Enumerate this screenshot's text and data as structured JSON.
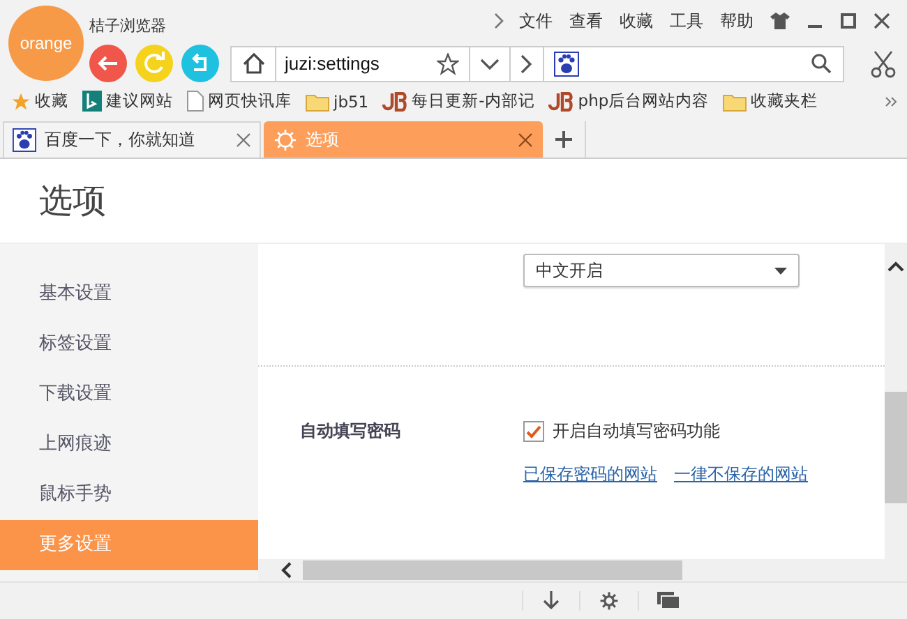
{
  "app": {
    "logo": "orange",
    "title": "桔子浏览器"
  },
  "menu": [
    "文件",
    "查看",
    "收藏",
    "工具",
    "帮助"
  ],
  "address": {
    "value": "juzi:settings"
  },
  "bookmarks": [
    {
      "kind": "star",
      "label": "收藏"
    },
    {
      "kind": "bing",
      "label": "建议网站"
    },
    {
      "kind": "page",
      "label": "网页快讯库"
    },
    {
      "kind": "folder",
      "label": "jb51"
    },
    {
      "kind": "jb",
      "label": "每日更新-内部记"
    },
    {
      "kind": "jb",
      "label": "php后台网站内容"
    },
    {
      "kind": "folder",
      "label": "收藏夹栏"
    }
  ],
  "tabs": [
    {
      "kind": "paw",
      "label": "百度一下，你就知道",
      "selected": false
    },
    {
      "kind": "gear",
      "label": "选项",
      "selected": true
    }
  ],
  "page": {
    "heading": "选项",
    "sidebar": [
      {
        "label": "基本设置",
        "selected": false
      },
      {
        "label": "标签设置",
        "selected": false
      },
      {
        "label": "下载设置",
        "selected": false
      },
      {
        "label": "上网痕迹",
        "selected": false
      },
      {
        "label": "鼠标手势",
        "selected": false
      },
      {
        "label": "更多设置",
        "selected": true
      }
    ],
    "dropdown": {
      "value": "中文开启"
    },
    "setting": {
      "label": "自动填写密码",
      "checkbox": {
        "label": "开启自动填写密码功能",
        "checked": true
      },
      "links": [
        "已保存密码的网站",
        "一律不保存的网站"
      ]
    }
  }
}
